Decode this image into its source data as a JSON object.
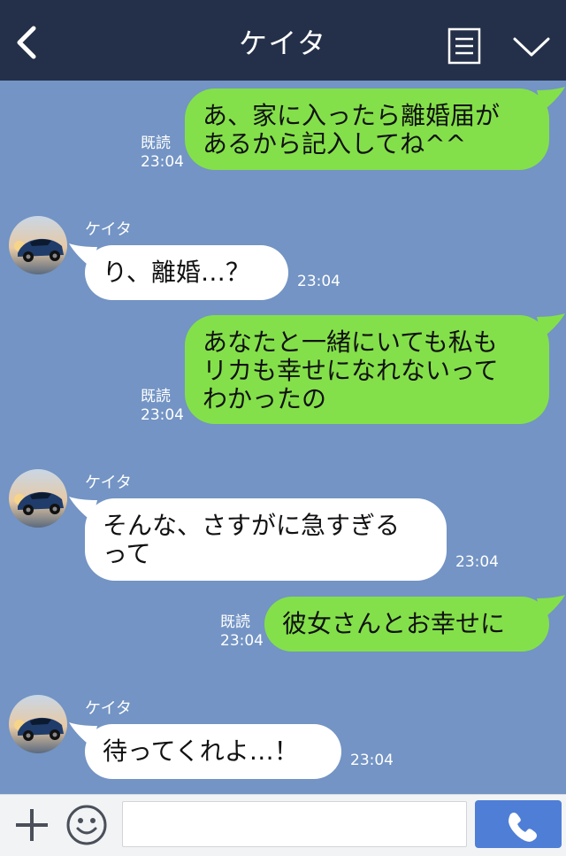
{
  "header": {
    "title": "ケイタ",
    "back_icon": "chevron-left-icon",
    "menu_icon": "notes-icon",
    "more_icon": "chevron-down-icon",
    "background": "#243049"
  },
  "chat": {
    "background": "#7394c4",
    "messages": [
      {
        "sender": "me",
        "text": "あ、家に入ったら離婚届が\nあるから記入してね^^",
        "read_label": "既読",
        "time": "23:04"
      },
      {
        "sender": "them",
        "name": "ケイタ",
        "text": "り、離婚…？",
        "time": "23:04"
      },
      {
        "sender": "me",
        "text": "あなたと一緒にいても私も\nリカも幸せになれないって\nわかったの",
        "read_label": "既読",
        "time": "23:04"
      },
      {
        "sender": "them",
        "name": "ケイタ",
        "text": "そんな、さすがに急すぎる\nって",
        "time": "23:04"
      },
      {
        "sender": "me",
        "text": "彼女さんとお幸せに",
        "read_label": "既読",
        "time": "23:04"
      },
      {
        "sender": "them",
        "name": "ケイタ",
        "text": "待ってくれよ…！",
        "time": "23:04"
      }
    ],
    "my_bubble_color": "#84e04a",
    "their_bubble_color": "#ffffff"
  },
  "footer": {
    "plus_icon": "plus-icon",
    "emoji_icon": "smiley-icon",
    "input_value": "",
    "call_icon": "phone-icon",
    "call_button_color": "#4f7ed6"
  }
}
